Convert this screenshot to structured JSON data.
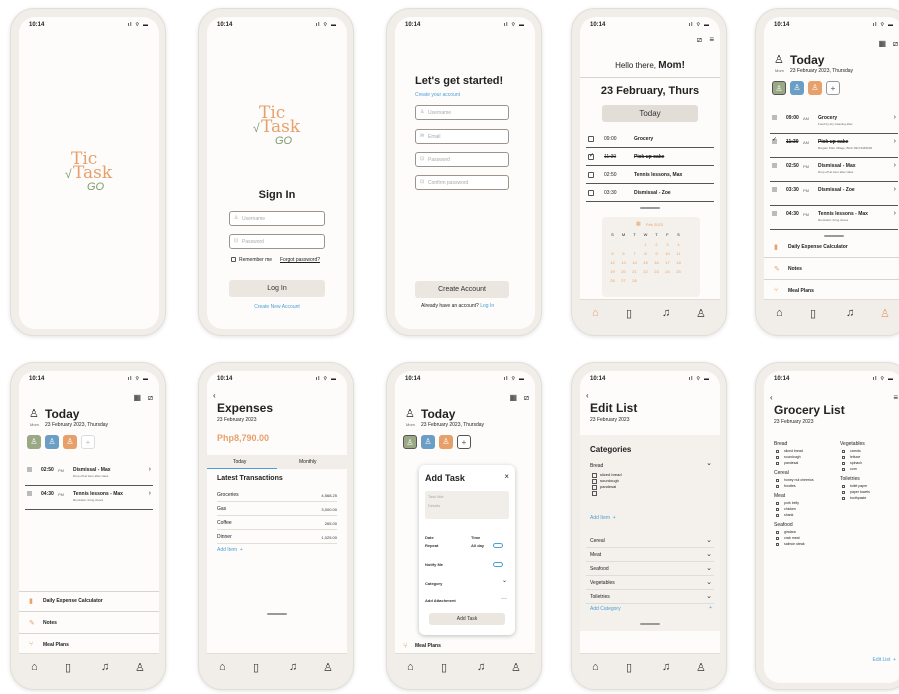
{
  "status": {
    "time": "10:14",
    "icons": "ıl ⌔ ▬"
  },
  "logo": {
    "tic": "Tic",
    "task": "Task",
    "go": "GO",
    "check": "√"
  },
  "signin": {
    "title": "Sign In",
    "username_ph": "Username",
    "password_ph": "Password",
    "remember": "Remember me",
    "forgot": "Forgot password?",
    "login": "Log In",
    "create": "Create New Account"
  },
  "start": {
    "title": "Let's get started!",
    "subtitle": "Create your account",
    "username_ph": "Username",
    "email_ph": "Email",
    "password_ph": "Password",
    "confirm_ph": "Confirm password",
    "create_btn": "Create Account",
    "have_account": "Already have an account?",
    "login_link": "Log In"
  },
  "home": {
    "greeting": "Hello there,",
    "name": "Mom!",
    "date": "23 February, Thurs",
    "today_btn": "Today",
    "tasks": [
      {
        "time": "09:00",
        "label": "Grocery",
        "done": false
      },
      {
        "time": "11:30",
        "label": "Pick up cake",
        "done": true
      },
      {
        "time": "02:50",
        "label": "Tennis lessons, Max",
        "done": false
      },
      {
        "time": "03:30",
        "label": "Dismissal - Zoe",
        "done": false
      }
    ],
    "cal_month": "Feb 2023",
    "cal_days": [
      "S",
      "M",
      "T",
      "W",
      "T",
      "F",
      "S"
    ],
    "cal_nums": [
      "",
      "",
      "",
      "1",
      "2",
      "3",
      "4",
      "5",
      "6",
      "7",
      "8",
      "9",
      "10",
      "11",
      "12",
      "13",
      "14",
      "15",
      "16",
      "17",
      "18",
      "19",
      "20",
      "21",
      "22",
      "23",
      "24",
      "25",
      "26",
      "27",
      "28",
      "",
      "",
      "",
      ""
    ]
  },
  "today": {
    "title": "Today",
    "who": "Mom",
    "date": "23 February 2023, Thursday",
    "tasks": [
      {
        "time": "09:00",
        "ampm": "AM",
        "label": "Grocery",
        "sub": "Food by dry cleaning after",
        "done": false
      },
      {
        "time": "11:30",
        "ampm": "AM",
        "label": "Pick up cake",
        "sub": "Bonjain Park Village, BGC 09172345020",
        "done": true
      },
      {
        "time": "02:50",
        "ampm": "PM",
        "label": "Dismissal - Max",
        "sub": "Drop off at tutor after class",
        "done": false
      },
      {
        "time": "03:30",
        "ampm": "PM",
        "label": "Dismissal - Zoe",
        "sub": "",
        "done": false
      },
      {
        "time": "04:30",
        "ampm": "PM",
        "label": "Tennis lessons - Max",
        "sub": "Reminder: bring shoes",
        "done": false
      }
    ],
    "menu": [
      "Daily Expense Calculator",
      "Notes",
      "Meal Plans"
    ]
  },
  "today2": {
    "tasks": [
      {
        "time": "02:50",
        "ampm": "PM",
        "label": "Dismissal - Max",
        "sub": "Drop off at tutor after class"
      },
      {
        "time": "04:30",
        "ampm": "PM",
        "label": "Tennis lessons - Max",
        "sub": "Reminder: bring shoes"
      }
    ]
  },
  "expenses": {
    "title": "Expenses",
    "date": "23 February 2023",
    "total": "Php8,790.00",
    "tab_today": "Today",
    "tab_monthly": "Monthly",
    "latest": "Latest Transactions",
    "rows": [
      {
        "name": "Groceries",
        "amt": "4,568.25"
      },
      {
        "name": "Gas",
        "amt": "3,000.00"
      },
      {
        "name": "Coffee",
        "amt": "265.00"
      },
      {
        "name": "Dinner",
        "amt": "1,025.00"
      }
    ],
    "add_item": "Add Item"
  },
  "addtask": {
    "title": "Add Task",
    "task_ph": "Task title",
    "details_ph": "Details",
    "date": "Date",
    "time": "Time",
    "repeat": "Repeat",
    "allday": "All day",
    "notify": "Notify Me",
    "category": "Category",
    "attachment": "Add Attachment",
    "add_btn": "Add Task"
  },
  "editlist": {
    "title": "Edit List",
    "date": "23 February 2023",
    "categories": "Categories",
    "bread": "Bread",
    "bread_items": [
      "sliced bread",
      "sourdough",
      "pandesal"
    ],
    "add_item": "Add Item",
    "cats": [
      "Cereal",
      "Meat",
      "Seafood",
      "Vegetables",
      "Toiletries"
    ],
    "add_category": "Add Category"
  },
  "grocery": {
    "title": "Grocery List",
    "date": "23 February 2023",
    "left": [
      {
        "h": "Bread",
        "items": [
          "sliced bread",
          "sourdough",
          "pandesal"
        ]
      },
      {
        "h": "Cereal",
        "items": [
          "honey nut cheerios",
          "froottes"
        ]
      },
      {
        "h": "Meat",
        "items": [
          "pork belly",
          "chicken",
          "shank"
        ]
      },
      {
        "h": "Seafood",
        "items": [
          "gindara",
          "crab meat",
          "salmon steak"
        ]
      }
    ],
    "right": [
      {
        "h": "Vegetables",
        "items": [
          "carrots",
          "lettuce",
          "spinach",
          "corn"
        ]
      },
      {
        "h": "Toiletries",
        "items": [
          "toilet paper",
          "paper towels",
          "toothpaste"
        ]
      }
    ],
    "edit": "Edit List"
  },
  "colors": {
    "accent": "#e8a06b",
    "blue": "#4a9fd4",
    "green": "#7a9b6a"
  }
}
